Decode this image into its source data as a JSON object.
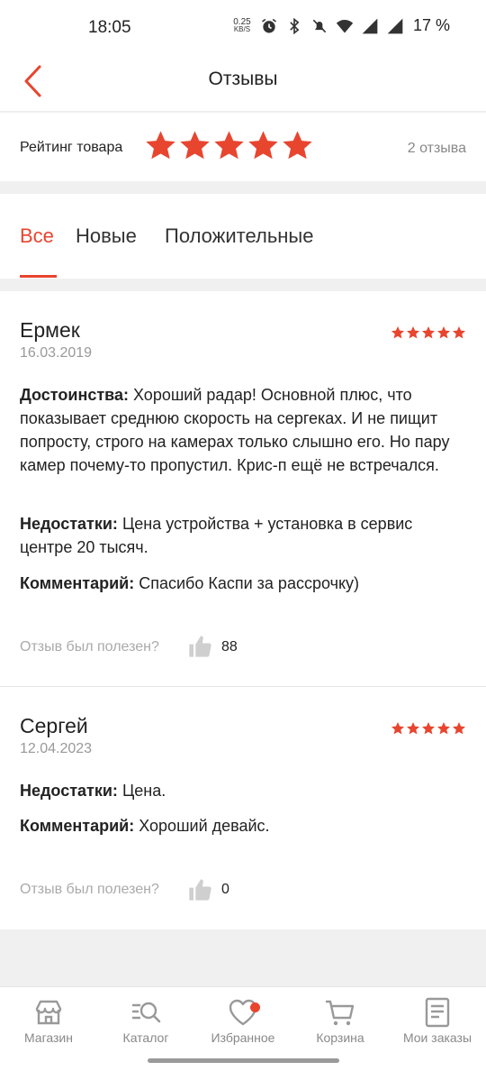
{
  "status_bar": {
    "time": "18:05",
    "net_speed_value": "0.25",
    "net_speed_unit": "KB/S",
    "battery": "17 %"
  },
  "header": {
    "title": "Отзывы"
  },
  "rating": {
    "label": "Рейтинг товара",
    "stars": 5,
    "count_text": "2 отзыва"
  },
  "tabs": [
    {
      "label": "Все",
      "active": true
    },
    {
      "label": "Новые",
      "active": false
    },
    {
      "label": "Положительные",
      "active": false
    }
  ],
  "reviews": [
    {
      "author": "Ермек",
      "date": "16.03.2019",
      "stars": 5,
      "pros_label": "Достоинства:",
      "pros_text": "Хороший радар! Основной плюс, что показывает среднюю скорость на сергеках. И не пищит попросту, строго на камерах только слышно его. Но пару камер почему-то пропустил. Крис-п ещё не встречался.",
      "cons_label": "Недостатки:",
      "cons_text": "Цена устройства + установка в сервис центре 20 тысяч.",
      "comment_label": "Комментарий:",
      "comment_text": "Спасибо Каспи за рассрочку)",
      "helpful_label": "Отзыв был полезен?",
      "helpful_count": "88"
    },
    {
      "author": "Сергей",
      "date": "12.04.2023",
      "stars": 5,
      "cons_label": "Недостатки:",
      "cons_text": "Цена.",
      "comment_label": "Комментарий:",
      "comment_text": "Хороший девайс.",
      "helpful_label": "Отзыв был полезен?",
      "helpful_count": "0"
    }
  ],
  "bottom_nav": [
    {
      "label": "Магазин",
      "icon": "store-icon"
    },
    {
      "label": "Каталог",
      "icon": "catalog-search-icon"
    },
    {
      "label": "Избранное",
      "icon": "heart-icon"
    },
    {
      "label": "Корзина",
      "icon": "cart-icon"
    },
    {
      "label": "Мои заказы",
      "icon": "orders-icon"
    }
  ],
  "colors": {
    "accent": "#e8452f",
    "muted_text": "#999999",
    "background": "#f0f0f0"
  }
}
